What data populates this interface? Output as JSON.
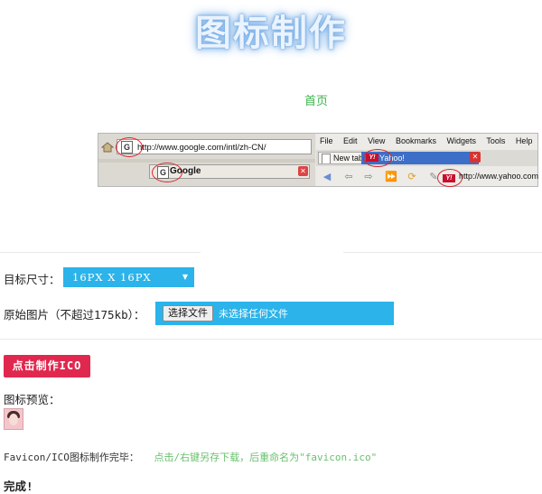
{
  "header": {
    "title": "图标制作",
    "home_link": "首页"
  },
  "demo_image": {
    "left_url": "http://www.google.com/intl/zh-CN/",
    "favicon_letter": "G",
    "search_label": "Google",
    "menu": [
      "File",
      "Edit",
      "View",
      "Bookmarks",
      "Widgets",
      "Tools",
      "Help"
    ],
    "new_tab_label": "New tab",
    "yahoo_tab_label": "Yahoo!",
    "yahoo_badge": "Y!",
    "right_url": "http://www.yahoo.com"
  },
  "form": {
    "target_size_label": "目标尺寸：",
    "target_size_value": "16PX   X   16PX",
    "source_image_label": "原始图片（不超过175kb）：",
    "file_button_label": "选择文件",
    "file_status": "未选择任何文件",
    "make_button_label": "点击制作ICO"
  },
  "result": {
    "preview_label": "图标预览：",
    "done_text": "Favicon/ICO图标制作完毕：",
    "download_link": "点击/右键另存下载，后重命名为\"favicon.ico\"",
    "finished_label": "完成!"
  },
  "colors": {
    "accent_blue": "#2bb3ea",
    "button_red": "#e0284f",
    "link_green": "#39b54a"
  }
}
